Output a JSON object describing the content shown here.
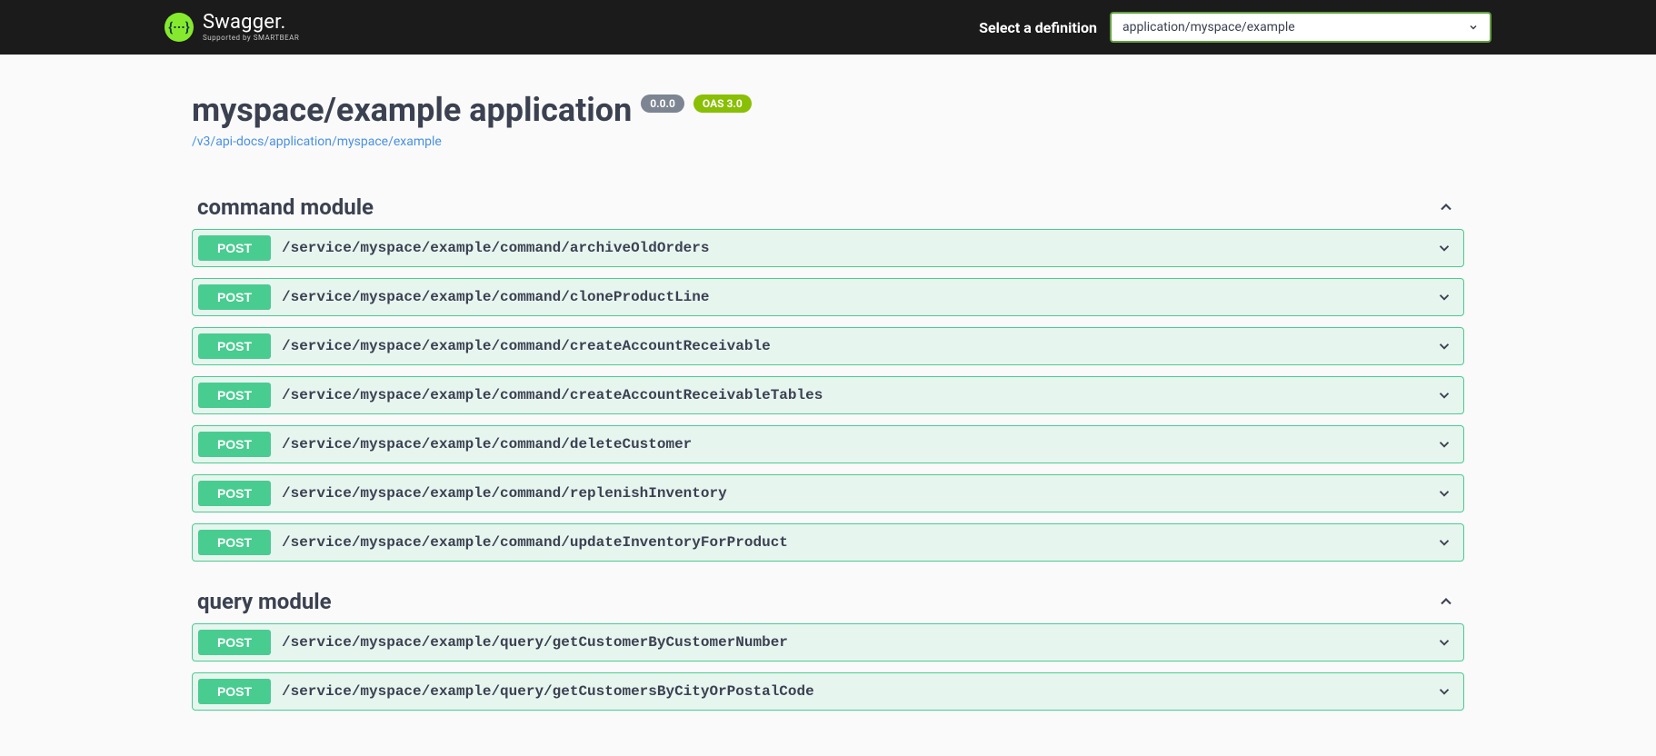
{
  "topbar": {
    "logo_main": "Swagger.",
    "logo_sub": "Supported by SMARTBEAR",
    "logo_glyph": "{···}",
    "definition_label": "Select a definition",
    "definition_selected": "application/myspace/example"
  },
  "info": {
    "title": "myspace/example application",
    "version": "0.0.0",
    "oas_badge": "OAS 3.0",
    "url": "/v3/api-docs/application/myspace/example"
  },
  "tags": [
    {
      "name": "command module",
      "operations": [
        {
          "method": "POST",
          "path": "/service/myspace/example/command/archiveOldOrders"
        },
        {
          "method": "POST",
          "path": "/service/myspace/example/command/cloneProductLine"
        },
        {
          "method": "POST",
          "path": "/service/myspace/example/command/createAccountReceivable"
        },
        {
          "method": "POST",
          "path": "/service/myspace/example/command/createAccountReceivableTables"
        },
        {
          "method": "POST",
          "path": "/service/myspace/example/command/deleteCustomer"
        },
        {
          "method": "POST",
          "path": "/service/myspace/example/command/replenishInventory"
        },
        {
          "method": "POST",
          "path": "/service/myspace/example/command/updateInventoryForProduct"
        }
      ]
    },
    {
      "name": "query module",
      "operations": [
        {
          "method": "POST",
          "path": "/service/myspace/example/query/getCustomerByCustomerNumber"
        },
        {
          "method": "POST",
          "path": "/service/myspace/example/query/getCustomersByCityOrPostalCode"
        }
      ]
    }
  ]
}
